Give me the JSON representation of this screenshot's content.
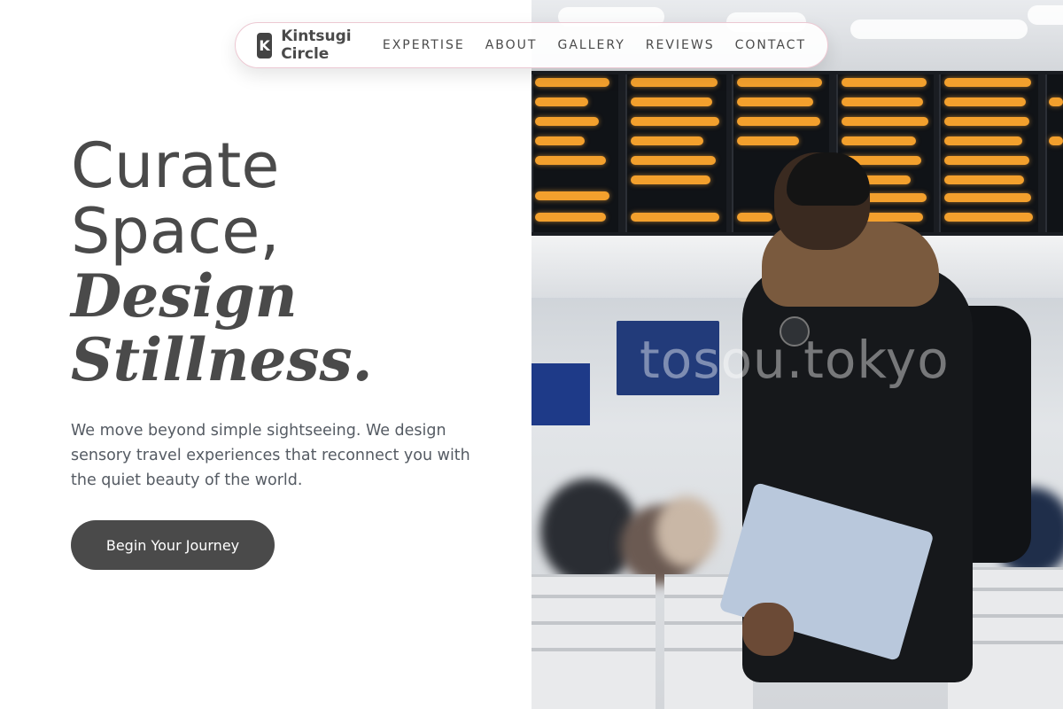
{
  "nav": {
    "logo_letter": "K",
    "brand": "Kintsugi Circle",
    "links": [
      "EXPERTISE",
      "ABOUT",
      "GALLERY",
      "REVIEWS",
      "CONTACT"
    ]
  },
  "hero": {
    "line1": "Curate",
    "line2": "Space,",
    "line3": "Design",
    "line4": "Stillness.",
    "description": "We move beyond simple sightseeing. We design sensory travel experiences that reconnect you with the quiet beauty of the world.",
    "cta": "Begin Your Journey"
  },
  "image": {
    "watermark": "tosou.tokyo"
  },
  "colors": {
    "text": "#4a4a4a",
    "button_bg": "#4a4a4a",
    "board_light": "#f3a02d",
    "nav_border": "#ecc8d2"
  }
}
